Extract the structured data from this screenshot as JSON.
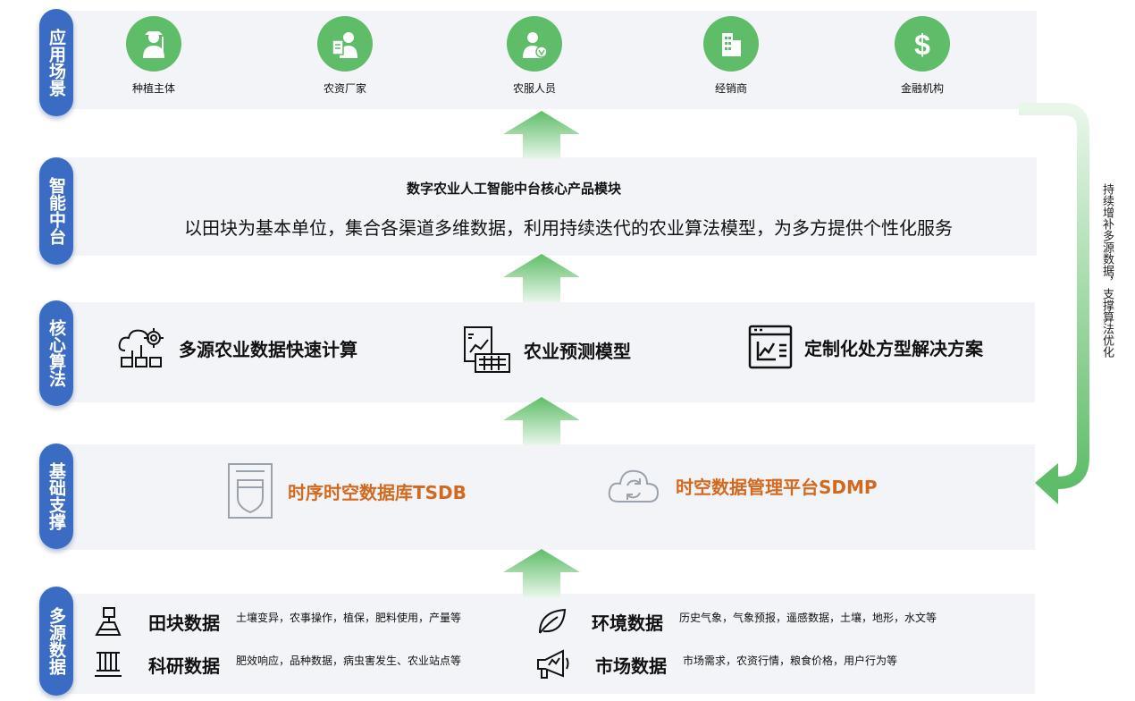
{
  "layers": {
    "app": "应用场景",
    "mid": "智能中台",
    "core": "核心算法",
    "base": "基础支撑",
    "data": "多源数据"
  },
  "app_scenes": [
    {
      "label": "种植主体",
      "icon": "farmer-icon"
    },
    {
      "label": "农资厂家",
      "icon": "supplier-icon"
    },
    {
      "label": "农服人员",
      "icon": "service-person-icon"
    },
    {
      "label": "经销商",
      "icon": "building-icon"
    },
    {
      "label": "金融机构",
      "icon": "dollar-icon"
    }
  ],
  "mid": {
    "title": "数字农业人工智能中台核心产品模块",
    "desc": "以田块为基本单位，集合各渠道多维数据，利用持续迭代的农业算法模型，为多方提供个性化服务"
  },
  "core_items": [
    {
      "label": "多源农业数据快速计算",
      "icon": "computing-gear-icon"
    },
    {
      "label": "农业预测模型",
      "icon": "chart-calculator-icon"
    },
    {
      "label": "定制化处方型解决方案",
      "icon": "report-chart-icon"
    }
  ],
  "base_items": [
    {
      "label": "时序时空数据库TSDB",
      "icon": "database-shield-icon"
    },
    {
      "label": "时空数据管理平台SDMP",
      "icon": "cloud-sync-icon"
    }
  ],
  "sources": [
    {
      "name": "田块数据",
      "desc": "土壤变异，农事操作，植保，肥料使用，产量等",
      "icon": "field-icon"
    },
    {
      "name": "科研数据",
      "desc": "肥效响应，品种数据，病虫害发生、农业站点等",
      "icon": "lab-icon"
    },
    {
      "name": "环境数据",
      "desc": "历史气象，气象预报，遥感数据，土壤，地形，水文等",
      "icon": "leaf-icon"
    },
    {
      "name": "市场数据",
      "desc": "市场需求，农资行情，粮食价格，用户行为等",
      "icon": "megaphone-icon"
    }
  ],
  "side_note": "持续增补多源数据，支撑算法优化",
  "colors": {
    "pill": "#3b6cc4",
    "band": "#f3f4f8",
    "green": "#5fbd69",
    "arrow_green": "#6cc47a",
    "orange": "#d2691e"
  }
}
